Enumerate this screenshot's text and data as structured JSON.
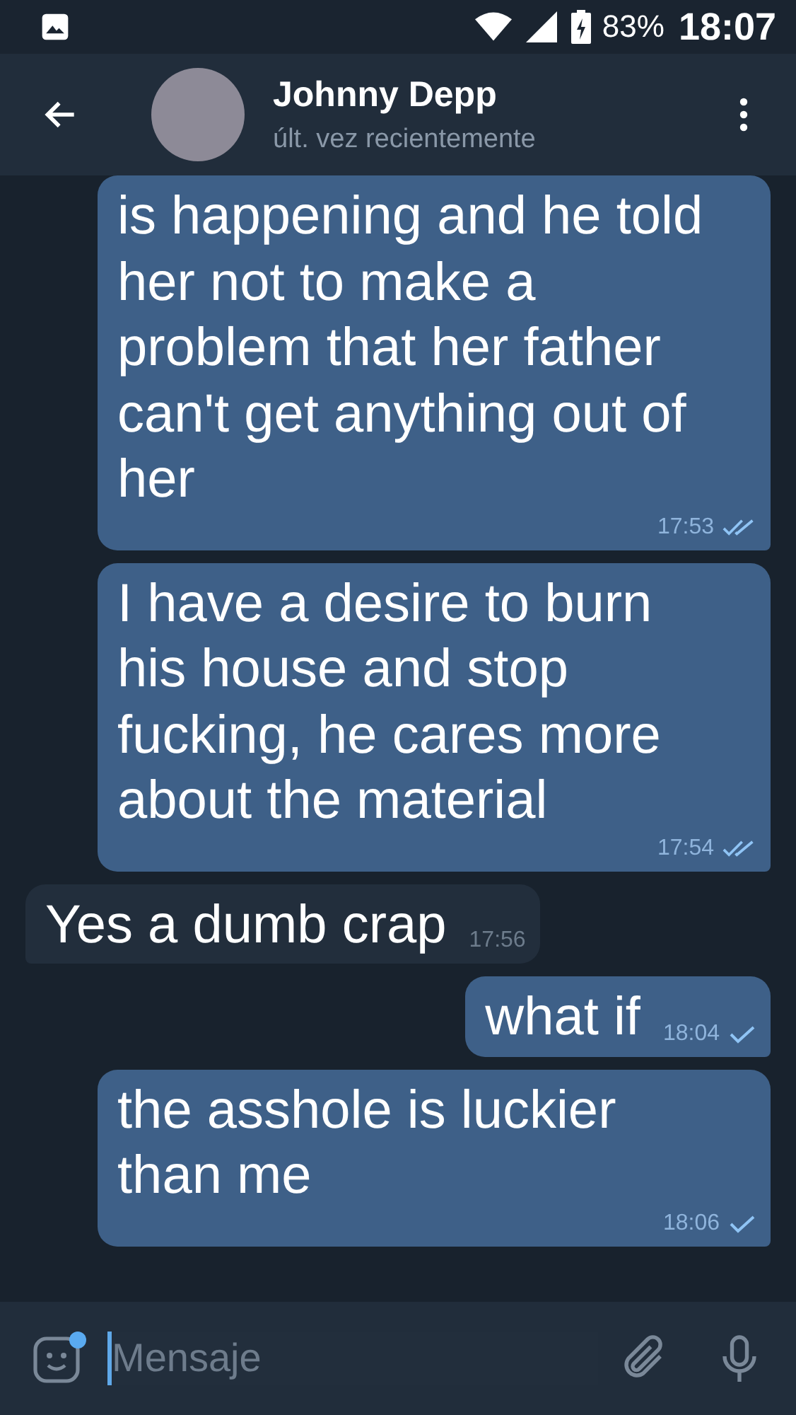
{
  "status_bar": {
    "battery": "83%",
    "time": "18:07"
  },
  "header": {
    "name": "Johnny Depp",
    "subtitle": "últ. vez recientemente"
  },
  "messages": [
    {
      "kind": "outgoing",
      "text": "is happening and he told her not to make a problem that her father can't get anything out of her",
      "time": "17:53",
      "read": true
    },
    {
      "kind": "outgoing",
      "text": "I have a desire to burn his house and stop fucking, he cares more about the material",
      "time": "17:54",
      "read": true
    },
    {
      "kind": "incoming",
      "text": "Yes a dumb crap",
      "time": "17:56"
    },
    {
      "kind": "outgoing",
      "text": "what if",
      "time": "18:04",
      "read": false
    },
    {
      "kind": "outgoing",
      "text": "the asshole is luckier than me",
      "time": "18:06",
      "read": false
    }
  ],
  "composer": {
    "placeholder": "Mensaje"
  }
}
